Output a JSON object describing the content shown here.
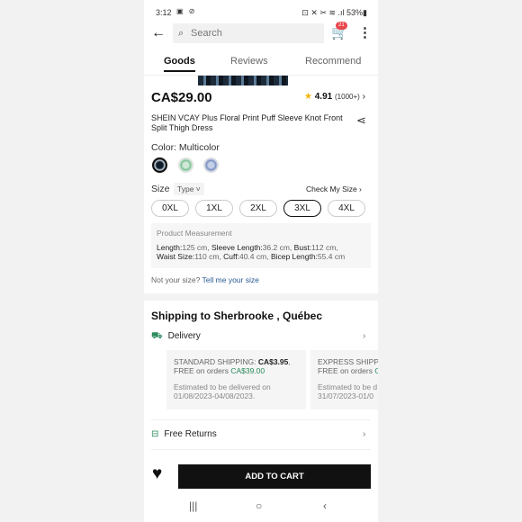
{
  "status": {
    "time": "3:12",
    "left_icons": "▣ ⊘",
    "right": "⊡ ✕ ✂ ≋ .ıl 53%▮"
  },
  "topnav": {
    "back_icon": "←",
    "search_icon": "⌕",
    "search_placeholder": "Search",
    "cart_icon": "🛒",
    "cart_badge": "21",
    "more_icon": "⋮"
  },
  "tabs": [
    {
      "label": "Goods"
    },
    {
      "label": "Reviews"
    },
    {
      "label": "Recommend"
    }
  ],
  "product": {
    "price": "CA$29.00",
    "rating_star": "★",
    "rating": "4.91",
    "rating_count": "(1000+)",
    "rating_chev": "›",
    "title": "SHEIN VCAY Plus Floral Print Puff Sleeve Knot Front Split Thigh Dress",
    "share_icon": "⋖",
    "color_label": "Color: Multicolor"
  },
  "size": {
    "label": "Size",
    "type": "Type ˅",
    "check": "Check My Size  ›",
    "options": [
      "0XL",
      "1XL",
      "2XL",
      "3XL",
      "4XL"
    ],
    "selected": "3XL"
  },
  "measurement": {
    "heading": "Product Measurement",
    "length_k": "Length:",
    "length_v": "125 cm, ",
    "sleeve_k": "Sleeve Length:",
    "sleeve_v": "36.2 cm, ",
    "bust_k": "Bust:",
    "bust_v": "112 cm,",
    "waist_k": "Waist Size:",
    "waist_v": "110 cm, ",
    "cuff_k": "Cuff:",
    "cuff_v": "40.4 cm, ",
    "bicep_k": "Bicep Length:",
    "bicep_v": "55.4 cm"
  },
  "notsize": {
    "text": "Not your size? ",
    "link": "Tell me your size"
  },
  "shipping": {
    "title": "Shipping to Sherbrooke , Québec",
    "delivery_icon": "⛟",
    "delivery": "Delivery",
    "chev": "›",
    "standard_label": "STANDARD SHIPPING: ",
    "standard_price": "CA$3.95",
    "standard_free_pre": "FREE on orders ",
    "standard_free_amt": "CA$39.00",
    "standard_est_1": "Estimated to be delivered on",
    "standard_est_2": "01/08/2023-04/08/2023.",
    "express_label": "EXPRESS SHIPPI",
    "express_free_pre": "FREE on orders ",
    "express_free_amt": "C",
    "express_est_1": "Estimated to be d",
    "express_est_2": "31/07/2023-01/0",
    "returns_icon": "⊟",
    "returns": "Free Returns"
  },
  "bottom": {
    "heart_icon": "♥",
    "add_to_cart": "ADD TO CART"
  },
  "sysnav": {
    "recent": "|||",
    "home": "○",
    "back": "‹"
  }
}
